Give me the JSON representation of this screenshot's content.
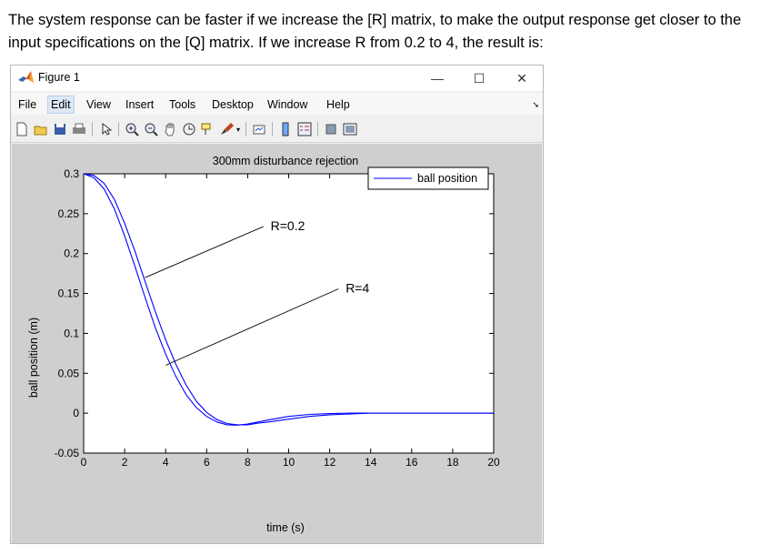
{
  "intro_text": "The system response can be faster if we increase the [R] matrix, to make the output response get closer to the input specifications on the [Q] matrix. If we increase R from 0.2 to 4, the result is:",
  "window": {
    "title": "Figure 1",
    "controls": {
      "minimize": "—",
      "maximize": "☐",
      "close": "✕"
    }
  },
  "menu": [
    "File",
    "Edit",
    "View",
    "Insert",
    "Tools",
    "Desktop",
    "Window",
    "Help"
  ],
  "toolbar_icons": [
    "new-figure-icon",
    "open-file-icon",
    "save-icon",
    "print-icon",
    "edit-plot-arrow-icon",
    "zoom-in-icon",
    "zoom-out-icon",
    "pan-hand-icon",
    "rotate-3d-icon",
    "data-cursor-icon",
    "brush-icon",
    "link-plot-icon",
    "colorbar-icon",
    "legend-icon",
    "hide-plot-tools-icon",
    "show-plot-tools-icon"
  ],
  "colors": {
    "line": "#0000ff",
    "axes_bg": "#ffffff",
    "figure_bg": "#cfcfcf"
  },
  "chart_data": {
    "type": "line",
    "title": "300mm disturbance rejection",
    "xlabel": "time (s)",
    "ylabel": "ball position (m)",
    "xlim": [
      0,
      20
    ],
    "ylim": [
      -0.05,
      0.3
    ],
    "xticks": [
      "0",
      "2",
      "4",
      "6",
      "8",
      "10",
      "12",
      "14",
      "16",
      "18",
      "20"
    ],
    "yticks": [
      "-0.05",
      "0",
      "0.05",
      "0.1",
      "0.15",
      "0.2",
      "0.25",
      "0.3"
    ],
    "legend": {
      "entries": [
        "ball position"
      ],
      "location": "top-right"
    },
    "series": [
      {
        "x": [
          0,
          0.5,
          1,
          1.5,
          2,
          2.5,
          3,
          3.5,
          4,
          4.5,
          5,
          5.5,
          6,
          6.5,
          7,
          7.5,
          8,
          8.5,
          9,
          10,
          11,
          12,
          13,
          14,
          16,
          18,
          20
        ],
        "values": [
          0.3,
          0.298,
          0.288,
          0.268,
          0.238,
          0.203,
          0.165,
          0.127,
          0.092,
          0.061,
          0.035,
          0.015,
          0.001,
          -0.008,
          -0.013,
          -0.0145,
          -0.0145,
          -0.0125,
          -0.011,
          -0.0075,
          -0.004,
          -0.002,
          -0.001,
          0,
          0,
          0,
          0
        ]
      },
      {
        "x": [
          0,
          0.5,
          1,
          1.5,
          2,
          2.5,
          3,
          3.5,
          4,
          4.5,
          5,
          5.5,
          6,
          6.5,
          7,
          7.5,
          8,
          8.5,
          9,
          10,
          11,
          12,
          13,
          14,
          16,
          18,
          20
        ],
        "values": [
          0.3,
          0.295,
          0.281,
          0.256,
          0.222,
          0.184,
          0.145,
          0.107,
          0.074,
          0.046,
          0.023,
          0.007,
          -0.004,
          -0.011,
          -0.0145,
          -0.015,
          -0.0135,
          -0.011,
          -0.0085,
          -0.004,
          -0.0015,
          -0.0005,
          0,
          0,
          0,
          0,
          0
        ]
      }
    ],
    "annotations": [
      {
        "text": "R=0.2",
        "points_to": [
          3,
          0.17
        ]
      },
      {
        "text": "R=4",
        "points_to": [
          4,
          0.06
        ]
      }
    ]
  }
}
